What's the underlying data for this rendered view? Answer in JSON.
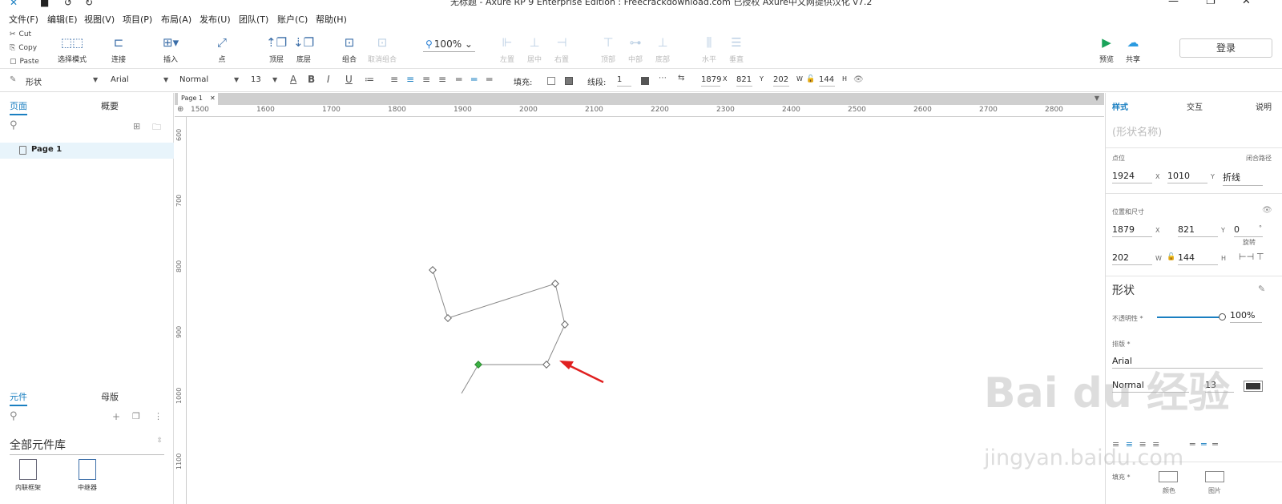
{
  "window": {
    "title": "无标题 - Axure RP 9 Enterprise Edition : Freecrackdownload.com 已授权 Axure中文网提供汉化 v7.2"
  },
  "menu": [
    "文件(F)",
    "编辑(E)",
    "视图(V)",
    "项目(P)",
    "布局(A)",
    "发布(U)",
    "团队(T)",
    "账户(C)",
    "帮助(H)"
  ],
  "clipboard": {
    "cut": "Cut",
    "copy": "Copy",
    "paste": "Paste"
  },
  "toolbar": {
    "select_mode": "选择模式",
    "connect": "连接",
    "insert": "插入",
    "point": "点",
    "top_layer": "顶层",
    "bottom_layer": "底层",
    "group": "组合",
    "ungroup": "取消组合",
    "zoom": "100%",
    "align_left": "左置",
    "align_center": "居中",
    "align_right": "右置",
    "align_top": "顶部",
    "align_middle": "中部",
    "align_bottom": "底部",
    "distribute_h": "水平",
    "distribute_v": "垂直",
    "preview": "预览",
    "share": "共享",
    "login": "登录"
  },
  "format": {
    "shape": "形状",
    "font": "Arial",
    "weight": "Normal",
    "size": "13",
    "fill_label": "填充:",
    "line_label": "线段:",
    "line_value": "1",
    "x": "1879",
    "x_unit": "X",
    "y": "821",
    "y_unit": "Y",
    "w": "202",
    "w_unit": "W",
    "h": "144",
    "h_unit": "H"
  },
  "left": {
    "tab_pages": "页面",
    "tab_outline": "概要",
    "page_name": "Page 1",
    "tab_widgets": "元件",
    "tab_masters": "母版",
    "library": "全部元件库",
    "widget1": "内联框架",
    "widget2": "中继器"
  },
  "canvas": {
    "page_tab": "Page 1",
    "ruler_x": [
      "1500",
      "1600",
      "1700",
      "1800",
      "1900",
      "2000",
      "2100",
      "2200",
      "2300",
      "2400",
      "2500",
      "2600",
      "2700",
      "2800"
    ],
    "ruler_y": [
      "600",
      "700",
      "800",
      "900",
      "1000",
      "1100"
    ]
  },
  "right": {
    "tab_style": "样式",
    "tab_interaction": "交互",
    "tab_notes": "说明",
    "shape_name_placeholder": "(形状名称)",
    "point_label": "点位",
    "closed_path": "闭合路径",
    "point_x": "1924",
    "point_y": "1010",
    "polyline": "折线",
    "pos_label": "位置和尺寸",
    "pos_x": "1879",
    "pos_y": "821",
    "rotation": "0",
    "rotation_unit": "°",
    "rotation_label": "旋转",
    "size_w": "202",
    "size_h": "144",
    "unit_x": "X",
    "unit_y": "Y",
    "unit_w": "W",
    "unit_h": "H",
    "shape_section": "形状",
    "opacity_label": "不透明性 *",
    "opacity_value": "100%",
    "opacity": 1.0,
    "typography_label": "排版 *",
    "font": "Arial",
    "weight": "Normal",
    "size": "13",
    "fill_label": "填充 *",
    "fill_color": "颜色",
    "fill_image": "图片"
  },
  "watermark": {
    "line1": "Bai du 经验",
    "line2": "jingyan.baidu.com"
  },
  "colors": {
    "accent": "#1a7fc1",
    "arrow": "#e02020",
    "selected_point": "#3cb043"
  }
}
